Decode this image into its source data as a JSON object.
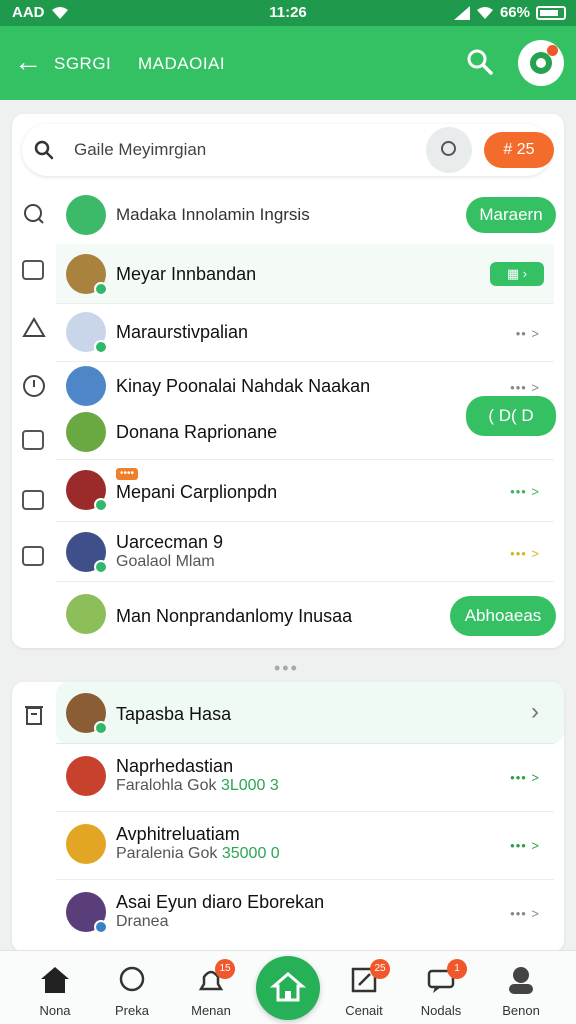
{
  "status_bar": {
    "carrier": "AAD",
    "time": "11:26",
    "battery": "66%"
  },
  "app_bar": {
    "tab1": "SGRGI",
    "tab2": "MADAOIAI"
  },
  "search": {
    "placeholder": "Gaile Meyimrgian",
    "pill_label": "# 25"
  },
  "list1": {
    "header": {
      "title": "Madaka Innolamin Ingrsis",
      "button": "Maraern"
    },
    "rows": [
      {
        "title": "Meyar Innbandan",
        "trail": "•• >"
      },
      {
        "title": "Maraurstivpalian",
        "trail": "•• >"
      },
      {
        "title": "Kinay Poonalai Nahdak Naakan",
        "trail": "••• >"
      },
      {
        "title": "Donana Raprionane",
        "button": "( D( D"
      },
      {
        "title": "Mepani Carplionpdn",
        "tag": "••••",
        "trail": "••• >"
      },
      {
        "title": "Uarcecman 9",
        "sub": "Goalaol Mlam",
        "trail": "••• >"
      },
      {
        "title": "Man Nonprandanlomy Inusaa",
        "button": "Abhoaeas"
      }
    ]
  },
  "dots": "•••",
  "list2": {
    "header": {
      "title": "Tapasba Hasa"
    },
    "rows": [
      {
        "title": "Naprhedastian",
        "sub": "Faralohla Gok",
        "amount": "3L000 3",
        "trail": "••• >"
      },
      {
        "title": "Avphitreluatiam",
        "sub": "Paralenia Gok",
        "amount": "35000 0",
        "trail": "••• >"
      },
      {
        "title": "Asai Eyun diaro Eborekan",
        "sub": "Dranea",
        "trail": "••• >"
      }
    ]
  },
  "bottom_nav": [
    {
      "label": "Nona"
    },
    {
      "label": "Preka"
    },
    {
      "label": "Menan",
      "badge": "15"
    },
    {
      "label": ""
    },
    {
      "label": "Cenait",
      "badge": "25"
    },
    {
      "label": "Nodals",
      "badge": "1"
    },
    {
      "label": "Benon"
    }
  ],
  "colors": {
    "primary": "#34c163",
    "status_bar": "#1f9a4c",
    "accent_orange": "#f36c2c",
    "badge": "#f0572b"
  }
}
